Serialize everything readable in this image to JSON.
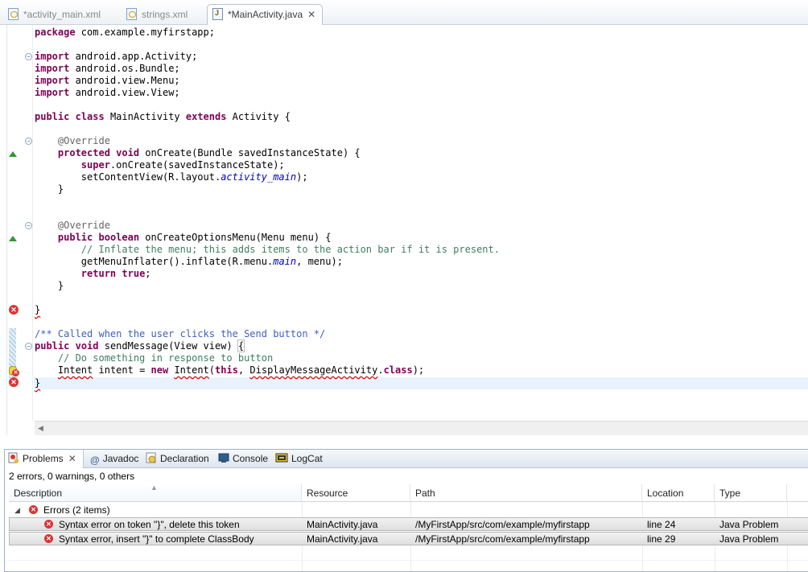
{
  "editor_tabs": [
    {
      "label": "*activity_main.xml",
      "icon": "xml-file-icon",
      "active": false
    },
    {
      "label": "strings.xml",
      "icon": "xml-file-icon",
      "active": false
    },
    {
      "label": "*MainActivity.java",
      "icon": "java-file-icon",
      "active": true
    }
  ],
  "code": {
    "package_kw": "package",
    "package_name": " com.example.myfirstapp;",
    "imports": [
      "android.app.Activity;",
      "android.os.Bundle;",
      "android.view.Menu;",
      "android.view.View;"
    ],
    "import_kw": "import",
    "class_decl": {
      "kw1": "public",
      "kw2": "class",
      "name": " MainActivity ",
      "kw3": "extends",
      "rest": " Activity {"
    },
    "override": "@Override",
    "oncreate_sig": {
      "kw1": "protected",
      "kw2": "void",
      "rest": " onCreate(Bundle savedInstanceState) {"
    },
    "super_call": {
      "kw": "super",
      "rest": ".onCreate(savedInstanceState);"
    },
    "set_content": {
      "pre": "setContentView(R.layout.",
      "field": "activity_main",
      "post": ");"
    },
    "close_brace": "}",
    "menu_sig": {
      "kw1": "public",
      "kw2": "boolean",
      "rest": " onCreateOptionsMenu(Menu menu) {"
    },
    "menu_comment": "// Inflate the menu; this adds items to the action bar if it is present.",
    "inflate": {
      "pre": "getMenuInflater().inflate(R.menu.",
      "field": "main",
      "post": ", menu);"
    },
    "return_stmt": {
      "kw": "return",
      "kw2": "true",
      "post": ";"
    },
    "javadoc": "/** Called when the user clicks the Send button */",
    "send_sig": {
      "kw1": "public",
      "kw2": "void",
      "rest": " sendMessage(View view) ",
      "brace": "{"
    },
    "send_comment": "// Do something in response to button",
    "intent_line": {
      "t1": "Intent",
      "t2": " intent = ",
      "kw": "new",
      "t3": " ",
      "t4": "Intent",
      "t5": "(",
      "kw2": "this",
      "t6": ", ",
      "t7": "DisplayMessageActivity",
      "t8": ".",
      "kw3": "class",
      "t9": ");"
    }
  },
  "view_tabs": [
    {
      "label": "Problems",
      "icon": "problems-icon",
      "active": true,
      "closable": true
    },
    {
      "label": "Javadoc",
      "icon": "at-icon",
      "active": false
    },
    {
      "label": "Declaration",
      "icon": "declaration-icon",
      "active": false
    },
    {
      "label": "Console",
      "icon": "console-icon",
      "active": false
    },
    {
      "label": "LogCat",
      "icon": "logcat-icon",
      "active": false
    }
  ],
  "problems": {
    "summary": "2 errors, 0 warnings, 0 others",
    "columns": [
      "Description",
      "Resource",
      "Path",
      "Location",
      "Type"
    ],
    "group_label": "Errors (2 items)",
    "rows": [
      {
        "description": "Syntax error on token \"}\", delete this token",
        "resource": "MainActivity.java",
        "path": "/MyFirstApp/src/com/example/myfirstapp",
        "location": "line 24",
        "type": "Java Problem"
      },
      {
        "description": "Syntax error, insert \"}\" to complete ClassBody",
        "resource": "MainActivity.java",
        "path": "/MyFirstApp/src/com/example/myfirstapp",
        "location": "line 29",
        "type": "Java Problem"
      }
    ]
  },
  "colors": {
    "keyword": "#7f0055",
    "comment": "#3f7f5f",
    "javadoc": "#3f5fbf",
    "field": "#0000c0",
    "error": "#dd3333"
  }
}
